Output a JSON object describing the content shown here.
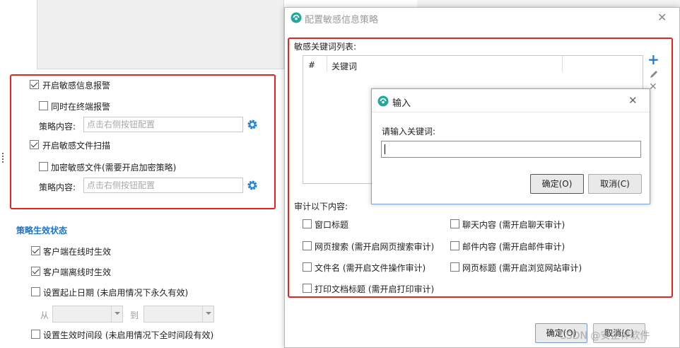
{
  "left_panel": {
    "enable_sensitive_alert": "开启敏感信息报警",
    "also_terminal_alert": "同时在终端报警",
    "policy_content_label_1": "策略内容:",
    "policy_placeholder_1": "点击右侧按钮配置",
    "enable_sensitive_scan": "开启敏感文件扫描",
    "encrypt_sensitive": "加密敏感文件(需要开启加密策略)",
    "policy_content_label_2": "策略内容:",
    "policy_placeholder_2": "点击右侧按钮配置",
    "status_heading": "策略生效状态",
    "client_online": "客户端在线时生效",
    "client_offline": "客户端离线时生效",
    "set_date_range": "设置起止日期 (未启用情况下永久有效)",
    "from_label": "从",
    "to_label": "到",
    "set_time_period": "设置生效时间段 (未启用情况下全时间段有效)"
  },
  "dialog": {
    "title": "配置敏感信息策略",
    "keyword_list_label": "敏感关键词列表:",
    "col_index": "#",
    "col_keyword": "关键词",
    "audit_label": "审计以下内容:",
    "audit_items": [
      "窗口标题",
      "聊天内容 (需开启聊天审计)",
      "网页搜索 (需开启网页搜索审计)",
      "邮件内容 (需开启邮件审计)",
      "文件名 (需开启文件操作审计)",
      "网页标题 (需开启浏览网站审计)",
      "打印文档标题 (需开启打印审计)"
    ],
    "ok": "确定(O)",
    "cancel": "取消(C)"
  },
  "input_dialog": {
    "title": "输入",
    "prompt": "请输入关键词:",
    "value": "",
    "ok": "确定(O)",
    "cancel": "取消(C)"
  },
  "watermark": "CSDN @安企神软件",
  "colors": {
    "highlight": "#e8231d",
    "heading_blue": "#1a73c9",
    "icon_blue": "#1e7fd6"
  }
}
